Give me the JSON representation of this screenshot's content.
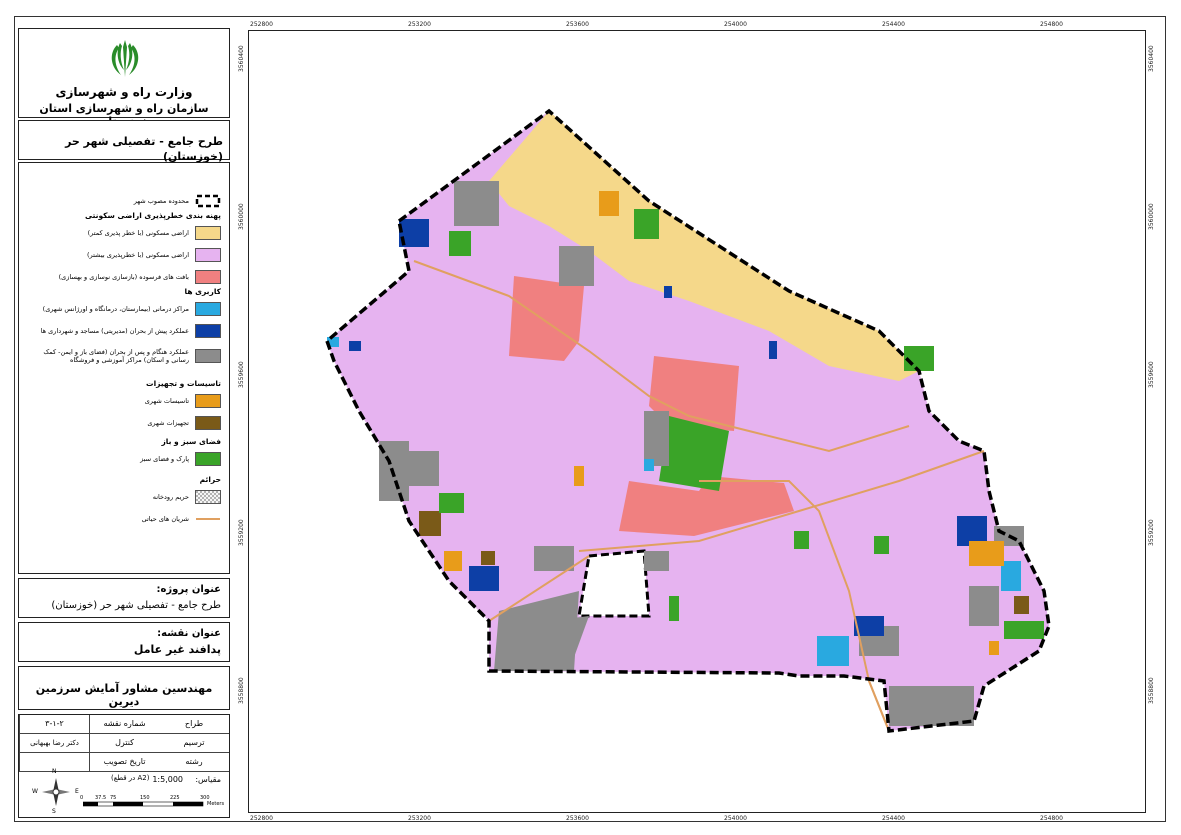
{
  "header": {
    "ministry": "وزارت راه و شهرسازی",
    "organization": "سازمان راه و شهرسازی استان خوزستان",
    "plan_title": "طرح جامع - تفصیلی شهر حر (خوزستان)"
  },
  "legend": {
    "boundary_label": "محدوده مصوب شهر",
    "section_residential": "پهنه بندی خطرپذیری اراضی سکونتی",
    "residential_items": [
      {
        "label": "اراضی مسکونی (با خطر پذیری کمتر)",
        "color": "#f5d88a"
      },
      {
        "label": "اراضی مسکونی (با خطرپذیری بیشتر)",
        "color": "#e6b3f0"
      },
      {
        "label": "بافت های فرسوده (بازسازی نوسازی و بهسازی)",
        "color": "#f08080"
      }
    ],
    "section_landuse": "کاربری ها",
    "landuse_items": [
      {
        "label": "مراکز درمانی (بیمارستان، درمانگاه و اورژانس شهری)",
        "color": "#29a9e0"
      },
      {
        "label": "عملکرد پیش از بحران (مدیریتی) مساجد و شهرداری ها",
        "color": "#0d3fa6"
      },
      {
        "label": "عملکرد هنگام و پس از بحران (فضای باز و ایمن- کمک رسانی و اسکان) مراکز آموزشی و فروشگاه",
        "color": "#8c8c8c"
      }
    ],
    "section_facilities": "تاسیسات و تجهیزات",
    "facilities_items": [
      {
        "label": "تاسیسات شهری",
        "color": "#e89c1a"
      },
      {
        "label": "تجهیزات شهری",
        "color": "#7a5a18"
      }
    ],
    "section_green": "فضای سبز و باز",
    "green_items": [
      {
        "label": "پارک و فضای سبز",
        "color": "#3aa428"
      }
    ],
    "section_buffer": "حرائم",
    "buffer_label": "حریم رودخانه",
    "arteries_label": "شریان های حیاتی"
  },
  "project": {
    "label": "عنوان پروژه:",
    "value": "طرح جامع - تفصیلی شهر حر (خوزستان)"
  },
  "map_title": {
    "label": "عنوان نقشه:",
    "value": "پدافند غیر عامل"
  },
  "consultant": "مهندسین مشاور آمایش سرزمین دیرین",
  "info_table": {
    "row1": {
      "k1": "طراح",
      "k2": "شماره نقشه",
      "v2": "۳-۱-۲"
    },
    "row2": {
      "k1": "ترسیم",
      "k2": "کنترل",
      "v2": "دکتر رضا بهبهانی"
    },
    "row3": {
      "k1": "رشته",
      "k2": "تاریخ تصویب",
      "v2": ""
    }
  },
  "scale": {
    "label": "مقیاس:",
    "value": "1:5,000",
    "sheet": "(در قطع A2)",
    "bar_ticks": [
      "0",
      "37.5",
      "75",
      "150",
      "225",
      "300"
    ],
    "unit": "Meters"
  },
  "north_arrow": {
    "n": "N",
    "s": "S",
    "e": "E",
    "w": "W"
  },
  "grid": {
    "x_labels": [
      "252800",
      "253200",
      "253600",
      "254000",
      "254400",
      "254800"
    ],
    "y_labels": [
      "3560400",
      "3560000",
      "3559600",
      "3559200",
      "3558800"
    ]
  },
  "colors": {
    "residential_low_risk": "#f5d88a",
    "residential_high_risk": "#e6b3f0",
    "worn_fabric": "#f08080",
    "green": "#3aa428",
    "open_space": "#8c8c8c",
    "medical": "#29a9e0",
    "management": "#0d3fa6",
    "facility": "#e89c1a",
    "equipment": "#7a5a18",
    "artery": "#e0a060"
  }
}
